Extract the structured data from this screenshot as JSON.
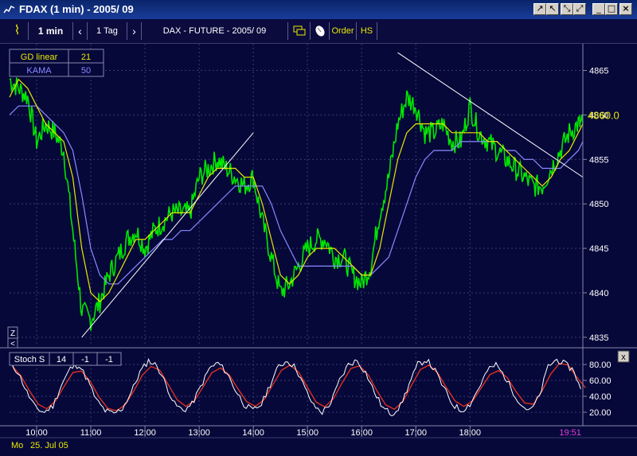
{
  "window": {
    "title": "FDAX  (1 min) - 2005/ 09",
    "controls": [
      "↗",
      "↖",
      "⤡",
      "⤢",
      "_",
      "□",
      "×"
    ]
  },
  "toolbar": {
    "chart_icon": "⌇",
    "interval": "1 min",
    "prev": "‹",
    "range": "1 Tag",
    "next": "›",
    "symbol": "DAX - FUTURE - 2005/ 09",
    "order": "Order",
    "hs": "HS"
  },
  "indicators": [
    {
      "name": "GD linear",
      "value": "21",
      "color": "#e8e800"
    },
    {
      "name": "KAMA",
      "value": "50",
      "color": "#8a8aff"
    }
  ],
  "stoch": {
    "name": "Stoch S",
    "p1": "14",
    "p2": "-1",
    "p3": "-1",
    "close": "x"
  },
  "zoom_label": "Z",
  "zoom_arrow": "<",
  "status": {
    "day": "Mo",
    "date": "25. Jul 05"
  },
  "colors": {
    "background": "#06083a",
    "price": "#00e600",
    "gd_linear": "#e8e800",
    "kama": "#8a8aff",
    "trendline": "#ffffff",
    "stoch_k": "#ffffff",
    "stoch_d": "#e03020",
    "grid": "#3a3c70",
    "cursor_time": "#e040e0"
  },
  "chart_data": [
    {
      "type": "line",
      "series": [
        {
          "name": "GD linear",
          "period": 21
        },
        {
          "name": "KAMA",
          "period": 50
        }
      ],
      "x": [
        "09:30",
        "09:40",
        "09:50",
        "10:00",
        "10:10",
        "10:20",
        "10:30",
        "10:40",
        "10:50",
        "11:00",
        "11:10",
        "11:20",
        "11:30",
        "11:40",
        "11:50",
        "12:00",
        "12:10",
        "12:20",
        "12:30",
        "12:40",
        "12:50",
        "13:00",
        "13:10",
        "13:20",
        "13:30",
        "13:40",
        "13:50",
        "14:00",
        "14:10",
        "14:20",
        "14:30",
        "14:40",
        "14:50",
        "15:00",
        "15:10",
        "15:20",
        "15:30",
        "15:40",
        "15:50",
        "16:00",
        "16:10",
        "16:20",
        "16:30",
        "16:40",
        "16:50",
        "17:00",
        "17:10",
        "17:20",
        "17:30",
        "17:40",
        "17:50",
        "18:00",
        "18:10",
        "18:20",
        "18:30",
        "18:40",
        "18:50",
        "19:00",
        "19:10",
        "19:20",
        "19:30",
        "19:40",
        "19:50",
        "20:00",
        "20:05"
      ],
      "price": [
        4864,
        4863,
        4862,
        4857,
        4859,
        4858,
        4856,
        4847,
        4838,
        4837,
        4839,
        4842,
        4844,
        4846,
        4847,
        4845,
        4847,
        4848,
        4849,
        4849,
        4849,
        4853,
        4854,
        4855,
        4854,
        4853,
        4852,
        4853,
        4848,
        4844,
        4840,
        4841,
        4843,
        4845,
        4846,
        4846,
        4844,
        4844,
        4842,
        4841,
        4843,
        4849,
        4853,
        4859,
        4862,
        4861,
        4858,
        4858,
        4859,
        4857,
        4857,
        4861,
        4858,
        4857,
        4856,
        4855,
        4854,
        4853,
        4852,
        4852,
        4854,
        4856,
        4858,
        4859,
        4859
      ],
      "gd_linear": [
        4862,
        4864,
        4863,
        4861,
        4859,
        4858,
        4857,
        4853,
        4845,
        4840,
        4839,
        4840,
        4842,
        4844,
        4846,
        4846,
        4847,
        4848,
        4849,
        4849,
        4849,
        4851,
        4853,
        4854,
        4854,
        4854,
        4853,
        4853,
        4850,
        4846,
        4842,
        4841,
        4842,
        4844,
        4845,
        4845,
        4845,
        4844,
        4843,
        4842,
        4842,
        4845,
        4850,
        4855,
        4858,
        4859,
        4859,
        4859,
        4859,
        4858,
        4858,
        4858,
        4858,
        4857,
        4857,
        4856,
        4855,
        4854,
        4853,
        4852,
        4853,
        4855,
        4856,
        4858,
        4859
      ],
      "kama": [
        4860,
        4861,
        4861,
        4861,
        4860,
        4859,
        4858,
        4856,
        4851,
        4845,
        4842,
        4841,
        4841,
        4842,
        4843,
        4844,
        4845,
        4846,
        4846,
        4847,
        4847,
        4848,
        4849,
        4850,
        4851,
        4852,
        4852,
        4852,
        4852,
        4850,
        4847,
        4845,
        4843,
        4843,
        4843,
        4843,
        4843,
        4843,
        4843,
        4842,
        4842,
        4843,
        4844,
        4847,
        4850,
        4853,
        4855,
        4856,
        4856,
        4856,
        4857,
        4857,
        4857,
        4857,
        4857,
        4856,
        4856,
        4855,
        4855,
        4854,
        4854,
        4854,
        4855,
        4856,
        4857
      ],
      "trendlines": [
        {
          "x": [
            "10:50",
            "14:00"
          ],
          "y": [
            4835,
            4858
          ]
        },
        {
          "x": [
            "16:40",
            "20:05"
          ],
          "y": [
            4867,
            4853
          ]
        }
      ],
      "last_price": "4860.0",
      "y_ticks": [
        "4865",
        "4860",
        "4855",
        "4850",
        "4845",
        "4840",
        "4835"
      ],
      "ylim": [
        4834,
        4868
      ],
      "x_ticks": [
        "10:00",
        "11:00",
        "12:00",
        "13:00",
        "14:00",
        "15:00",
        "16:00",
        "17:00",
        "18:00"
      ],
      "cursor_time": "19:51",
      "grid": true
    },
    {
      "type": "line",
      "title": "Stoch S",
      "series": [
        {
          "name": "%K",
          "color": "#ffffff"
        },
        {
          "name": "%D",
          "color": "#e03020"
        }
      ],
      "k": [
        82,
        70,
        45,
        25,
        20,
        28,
        55,
        75,
        80,
        60,
        35,
        22,
        18,
        25,
        45,
        70,
        85,
        78,
        55,
        30,
        22,
        30,
        52,
        75,
        82,
        70,
        48,
        30,
        22,
        30,
        55,
        78,
        85,
        75,
        50,
        28,
        20,
        32,
        60,
        80,
        85,
        70,
        45,
        25,
        18,
        28,
        55,
        80,
        86,
        72,
        50,
        30,
        22,
        30,
        50,
        72,
        80,
        65,
        45,
        28,
        22,
        40,
        78,
        86,
        80,
        72,
        40
      ],
      "y_ticks": [
        "80.00",
        "60.00",
        "40.00",
        "20.00"
      ],
      "ylim": [
        5,
        95
      ]
    }
  ]
}
